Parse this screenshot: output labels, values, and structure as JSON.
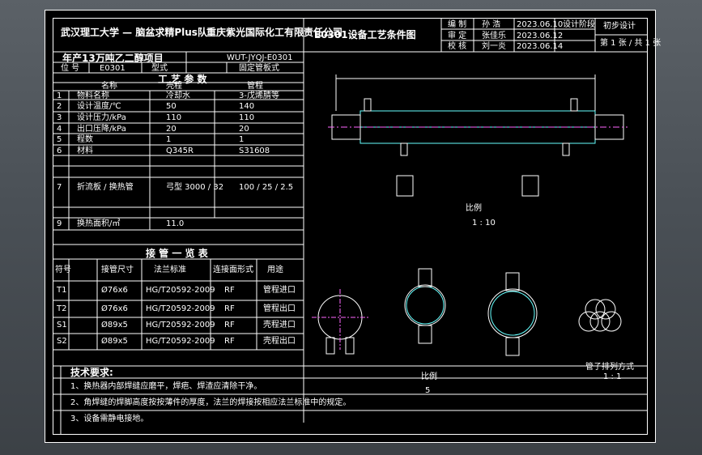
{
  "title_block": {
    "university": "武汉理工大学 — 脑盆求精Plus队",
    "company": "重庆紫光国际化工有限责任公司",
    "project": "年产13万吨乙二醇项目",
    "drawing_no": "WUT-JYQJ-E0301",
    "drawing_title": "E0301设备工艺条件图",
    "signoff": [
      {
        "role": "编 制",
        "name": "孙 浩",
        "date": "2023.06.10"
      },
      {
        "role": "审 定",
        "name": "张佳乐",
        "date": "2023.06.12"
      },
      {
        "role": "校 核",
        "name": "刘一炎",
        "date": "2023.06.14"
      }
    ],
    "stage_label": "设计阶段",
    "stage_value": "初步设计",
    "sheet": "第 1 张 / 共 1 张",
    "tag_label": "位 号",
    "tag_value": "E0301",
    "type_label": "型式",
    "type_value": "固定管板式"
  },
  "process": {
    "title": "工 艺 参 数",
    "columns": [
      "名称",
      "壳程",
      "管程"
    ],
    "rows": [
      {
        "no": "1",
        "name": "物料名称",
        "shell": "冷却水",
        "tube": "3-戊烯腈等"
      },
      {
        "no": "2",
        "name": "设计温度/℃",
        "shell": "50",
        "tube": "140"
      },
      {
        "no": "3",
        "name": "设计压力/kPa",
        "shell": "110",
        "tube": "110"
      },
      {
        "no": "4",
        "name": "出口压降/kPa",
        "shell": "20",
        "tube": "20"
      },
      {
        "no": "5",
        "name": "程数",
        "shell": "1",
        "tube": "1"
      },
      {
        "no": "6",
        "name": "材料",
        "shell": "Q345R",
        "tube": "S31608"
      },
      {
        "no": "7",
        "name": "折流板 / 换热管",
        "shell": "弓型 3000 / 32",
        "tube": "100 / 25 / 2.5"
      },
      {
        "no": "9",
        "name": "换热面积/㎡",
        "shell": "11.0",
        "tube": ""
      }
    ]
  },
  "nozzles": {
    "title": "接 管 一 览 表",
    "columns": [
      "符号",
      "接管尺寸",
      "法兰标准",
      "连接面形式",
      "用途"
    ],
    "rows": [
      {
        "code": "T1",
        "size": "Ø76x6",
        "std": "HG/T20592-2009",
        "face": "RF",
        "use": "管程进口"
      },
      {
        "code": "T2",
        "size": "Ø76x6",
        "std": "HG/T20592-2009",
        "face": "RF",
        "use": "管程出口"
      },
      {
        "code": "S1",
        "size": "Ø89x5",
        "std": "HG/T20592-2009",
        "face": "RF",
        "use": "壳程进口"
      },
      {
        "code": "S2",
        "size": "Ø89x5",
        "std": "HG/T20592-2009",
        "face": "RF",
        "use": "壳程出口"
      }
    ]
  },
  "tech": {
    "title": "技术要求:",
    "items": [
      "1、换热器内部焊缝应磨平，焊疤、焊渣应清除干净。",
      "2、角焊缝的焊脚高度按按薄件的厚度，法兰的焊接按相应法兰标准中的规定。",
      "3、设备需静电接地。"
    ]
  },
  "views": {
    "label1": "比例",
    "scale1": "1 : 10",
    "label2": "比例",
    "scale2": "5",
    "label3": "管子排列方式",
    "scale3": "1 : 1"
  }
}
